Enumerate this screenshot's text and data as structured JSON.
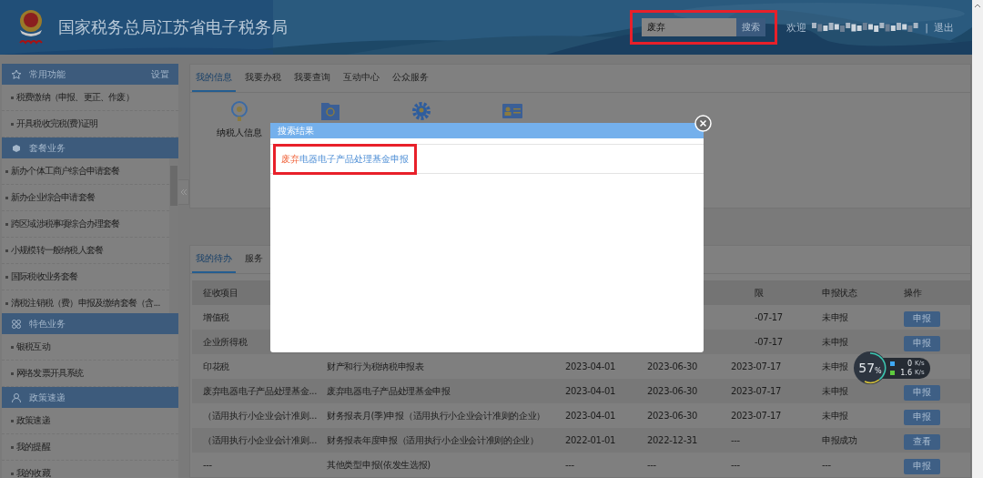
{
  "header": {
    "title": "国家税务总局江苏省电子税务局",
    "search": {
      "value": "废弃",
      "button": "搜索",
      "highlighted": true
    },
    "welcome": "欢迎",
    "separator": "|",
    "logout": "退出"
  },
  "sidebar": [
    {
      "kind": "star",
      "title": "常用功能",
      "action": "设置",
      "items": [
        "税费缴纳（申报、更正、作废）",
        "开具税收完税(费)证明"
      ]
    },
    {
      "kind": "box",
      "title": "套餐业务",
      "scroll": true,
      "items": [
        "新办个体工商户综合申请套餐",
        "新办企业综合申请套餐",
        "跨区域涉税事项综合办理套餐",
        "小规模转一般纳税人套餐",
        "国际税收业务套餐",
        "清税注销税（费）申报及缴纳套餐（含..."
      ]
    },
    {
      "kind": "grid",
      "title": "特色业务",
      "items": [
        "银税互动",
        "网络发票开具系统"
      ]
    },
    {
      "kind": "person",
      "title": "政策速递",
      "items": [
        "政策速递",
        "我的提醒",
        "我的收藏"
      ]
    }
  ],
  "main_tabs": [
    {
      "label": "我的信息",
      "selected": true
    },
    {
      "label": "我要办税",
      "selected": false
    },
    {
      "label": "我要查询",
      "selected": false
    },
    {
      "label": "互动中心",
      "selected": false
    },
    {
      "label": "公众服务",
      "selected": false
    }
  ],
  "info_items": [
    {
      "kind": "badge",
      "label": "纳税人信息"
    },
    {
      "kind": "folder"
    },
    {
      "kind": "gear"
    },
    {
      "kind": "card"
    }
  ],
  "todo_tabs": [
    {
      "label": "我的待办",
      "selected": true
    },
    {
      "label": "服务",
      "selected": false
    }
  ],
  "table": {
    "columns": [
      "征收项目",
      null,
      null,
      null,
      "限",
      "申报状态",
      "操作"
    ],
    "rows": [
      {
        "cells": [
          "增值税",
          null,
          null,
          null,
          "-07-17",
          "未申报"
        ],
        "action": "申报"
      },
      {
        "cells": [
          "企业所得税",
          null,
          null,
          null,
          "-07-17",
          "未申报"
        ],
        "action": "申报"
      },
      {
        "cells": [
          "印花税",
          "财产和行为税纳税申报表",
          "2023-04-01",
          "2023-06-30",
          "2023-07-17",
          "未申报"
        ],
        "action": null
      },
      {
        "cells": [
          "废弃电器电子产品处理基金...",
          "废弃电器电子产品处理基金申报",
          "2023-04-01",
          "2023-06-30",
          "2023-07-17",
          "未申报"
        ],
        "action": "申报"
      },
      {
        "cells": [
          "（适用执行小企业会计准则...",
          "财务报表月(季)申报（适用执行小企业会计准则的企业）",
          "2023-04-01",
          "2023-06-30",
          "2023-07-17",
          "未申报"
        ],
        "action": "申报"
      },
      {
        "cells": [
          "（适用执行小企业会计准则...",
          "财务报表年度申报（适用执行小企业会计准则的企业）",
          "2022-01-01",
          "2022-12-31",
          "---",
          "申报成功"
        ],
        "action": "查看"
      },
      {
        "cells": [
          "---",
          "其他类型申报(依发生选报)",
          "---",
          "---",
          "---",
          "---"
        ],
        "action": "申报"
      }
    ]
  },
  "dialog": {
    "title": "搜索结果",
    "results": [
      {
        "match": "废弃",
        "rest": "电器电子产品处理基金申报",
        "highlighted": true
      }
    ]
  },
  "speed_widget": {
    "percent": "57",
    "percent_unit": "%",
    "rows": [
      {
        "value": "0",
        "unit": "K/s",
        "color": "#3fa9f5"
      },
      {
        "value": "1.6",
        "unit": "K/s",
        "color": "#5ecb3f"
      }
    ]
  }
}
